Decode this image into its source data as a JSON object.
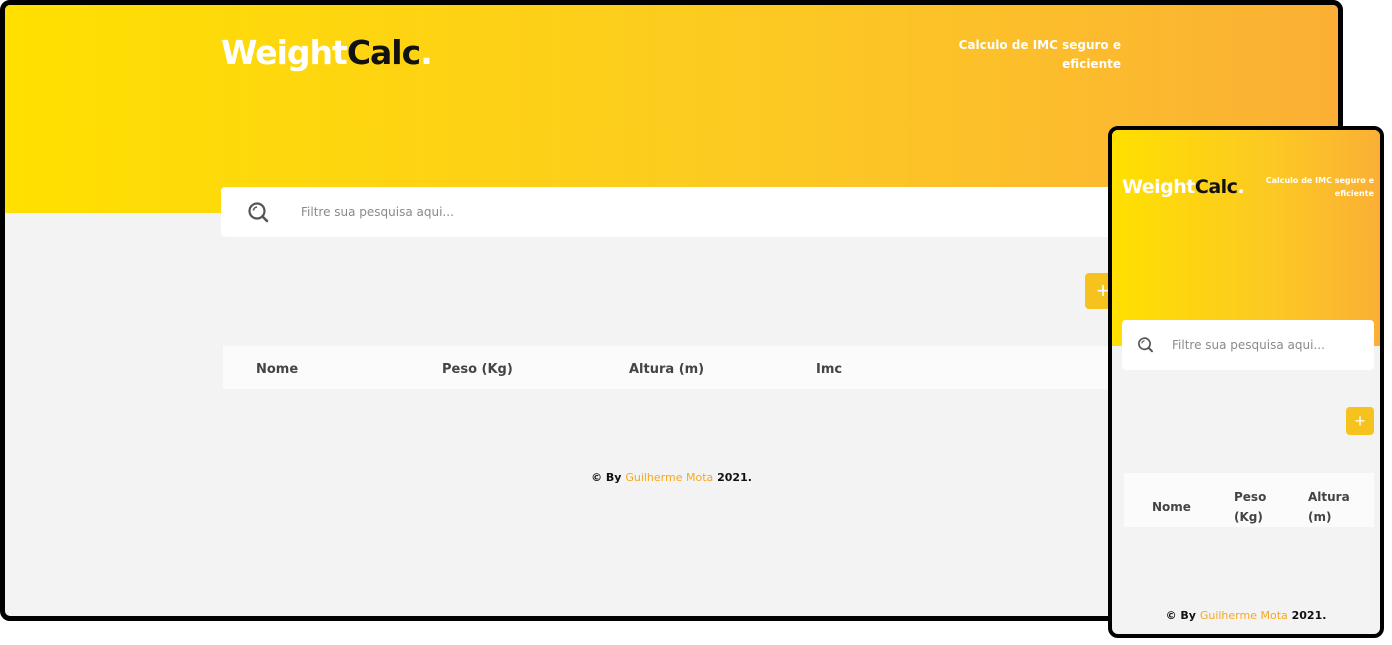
{
  "brand": {
    "logo_part1": "Weight",
    "logo_part2": "Calc",
    "logo_dot": ".",
    "tagline": "Calculo de IMC seguro e eficiente"
  },
  "search": {
    "placeholder": "Filtre sua pesquisa aqui...",
    "icon": "search-icon"
  },
  "add_button": {
    "label": "+",
    "icon": "plus-icon"
  },
  "table": {
    "columns": [
      "Nome",
      "Peso (Kg)",
      "Altura (m)",
      "Imc"
    ]
  },
  "mobile_table": {
    "col1": "Nome",
    "col2_line1": "Peso",
    "col2_line2": "(Kg)",
    "col3_line1": "Altura",
    "col3_line2": "(m)"
  },
  "footer": {
    "prefix": "© By",
    "author": "Guilherme Mota",
    "year": "2021."
  },
  "colors": {
    "accent_yellow": "#ffe000",
    "accent_orange": "#fbb035",
    "button": "#f6c31e",
    "author_link": "#f7a81b",
    "background": "#f3f3f3"
  }
}
